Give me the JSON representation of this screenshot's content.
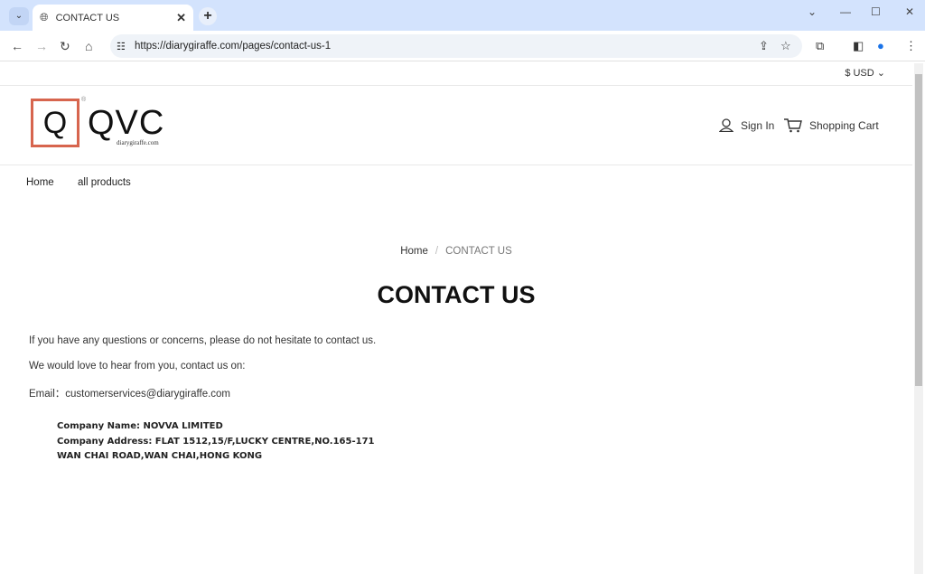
{
  "browser": {
    "tab_title": "CONTACT US",
    "url": "https://diarygiraffe.com/pages/contact-us-1"
  },
  "header": {
    "currency": "$ USD",
    "logo_text": "QVC",
    "logo_letter": "Q",
    "logo_sub": "diarygiraffe.com",
    "sign_in": "Sign In",
    "cart": "Shopping Cart"
  },
  "menu": [
    {
      "label": "Home"
    },
    {
      "label": "all products"
    }
  ],
  "breadcrumb": {
    "home": "Home",
    "sep": "/",
    "current": "CONTACT US"
  },
  "page": {
    "title": "CONTACT US",
    "line1": "If you have any questions or concerns, please do not hesitate to contact us.",
    "line2": "We would love to hear from you, contact us on:",
    "email_label": "Email：",
    "email": "customerservices@diarygiraffe.com",
    "company_name": "Company Name: NOVVA LIMITED",
    "company_address_1": "Company Address: FLAT 1512,15/F,LUCKY CENTRE,NO.165-171",
    "company_address_2": "WAN CHAI ROAD,WAN CHAI,HONG KONG"
  },
  "colors": {
    "logo_accent": "#d7654e",
    "tabbar": "#d3e3fd"
  }
}
